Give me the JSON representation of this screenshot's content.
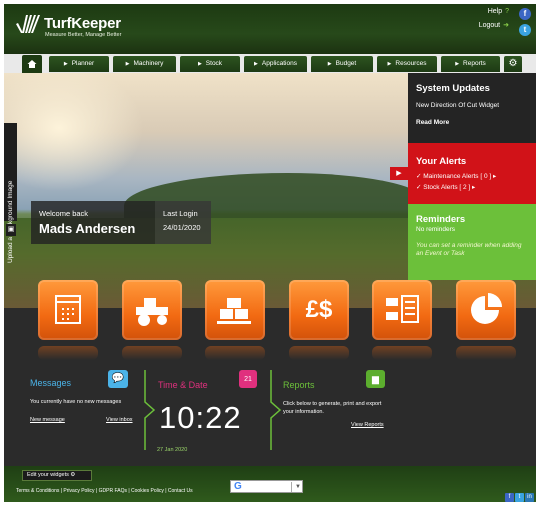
{
  "header": {
    "title": "TurfKeeper",
    "tagline": "Measure Better, Manage Better",
    "help": "Help",
    "logout": "Logout"
  },
  "nav": {
    "items": [
      "Planner",
      "Machinery",
      "Stock",
      "Applications",
      "Budget",
      "Resources",
      "Reports"
    ]
  },
  "hero": {
    "upload_label": "Upload a Background Image",
    "welcome_label": "Welcome back",
    "user_name": "Mads Andersen",
    "last_login_label": "Last Login",
    "last_login_date": "24/01/2020"
  },
  "system_updates": {
    "title": "System Updates",
    "item": "New Direction Of Cut Widget",
    "read_more": "Read More"
  },
  "alerts": {
    "title": "Your Alerts",
    "maintenance": "Maintenance Alerts [ 0 ] ▸",
    "stock": "Stock Alerts [ 2 ] ▸"
  },
  "reminders": {
    "title": "Reminders",
    "status": "No reminders",
    "hint": "You can set a reminder when adding an Event or Task"
  },
  "tiles": [
    "calendar-icon",
    "tractor-icon",
    "pallet-icon",
    "currency-icon",
    "resources-icon",
    "reports-pie-icon"
  ],
  "tile_glyphs": {
    "currency": "£$"
  },
  "messages": {
    "title": "Messages",
    "status": "You currently have no new messages",
    "new_message": "New message",
    "view_inbox": "View inbox"
  },
  "time_date": {
    "title": "Time & Date",
    "time": "10:22",
    "date": "27 Jan 2020",
    "calendar_day": "21"
  },
  "reports": {
    "title": "Reports",
    "text": "Click below to generate, print and export your information.",
    "view": "View Reports"
  },
  "footer": {
    "edit_widgets": "Edit your widgets",
    "links": "Terms & Conditions | Privacy Policy | GDPR FAQs | Cookies Policy | Contact Us"
  },
  "colors": {
    "accent_orange": "#f26a12",
    "alerts_red": "#d11218",
    "reminders_green": "#6cc03a",
    "messages_blue": "#4bb3e8",
    "time_pink": "#e0307e"
  }
}
